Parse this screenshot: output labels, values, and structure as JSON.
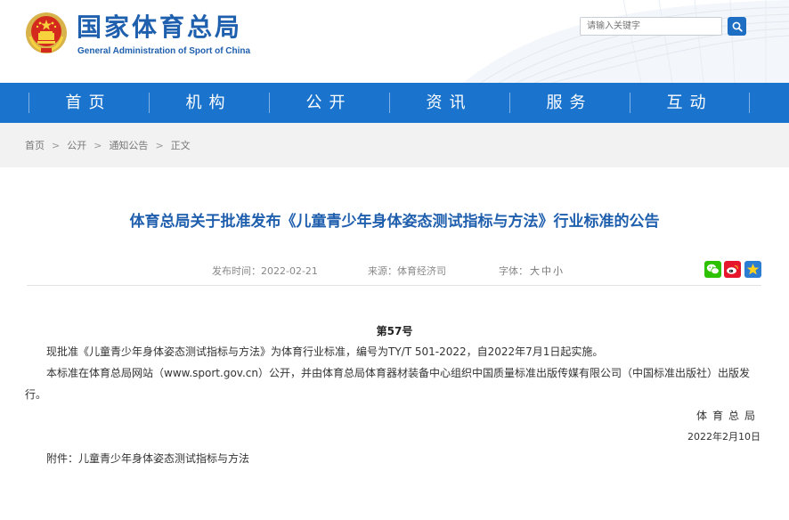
{
  "header": {
    "title": "国家体育总局",
    "subtitle": "General Administration of Sport of China",
    "search": {
      "placeholder": "请输入关键字"
    }
  },
  "nav": {
    "items": [
      {
        "label": "首页"
      },
      {
        "label": "机构"
      },
      {
        "label": "公开"
      },
      {
        "label": "资讯"
      },
      {
        "label": "服务"
      },
      {
        "label": "互动"
      }
    ]
  },
  "breadcrumb": {
    "items": [
      "首页",
      "公开",
      "通知公告",
      "正文"
    ],
    "separator": ">"
  },
  "article": {
    "title": "体育总局关于批准发布《儿童青少年身体姿态测试指标与方法》行业标准的公告",
    "date_label": "发布时间：2022-02-21",
    "source_label": "来源：体育经济司",
    "font_label": "字体：",
    "font_sizes": [
      "大",
      "中",
      "小"
    ],
    "doc_number": "第57号",
    "paragraph1": "现批准《儿童青少年身体姿态测试指标与方法》为体育行业标准，编号为TY/T 501-2022，自2022年7月1日起实施。",
    "paragraph2": "本标准在体育总局网站（www.sport.gov.cn）公开，并由体育总局体育器材装备中心组织中国质量标准出版传媒有限公司（中国标准出版社）出版发行。",
    "signature_org": "体育总局",
    "signature_date": "2022年2月10日",
    "attachment": "附件：儿童青少年身体姿态测试指标与方法"
  },
  "share": {
    "icons": [
      "wechat-icon",
      "weibo-icon",
      "favorite-star-icon"
    ]
  },
  "colors": {
    "brand_blue": "#1e5fae",
    "nav_blue": "#1a73cc",
    "wechat_green": "#2dc100",
    "weibo_red": "#e6162d",
    "favorite_blue": "#2b7cd3"
  }
}
